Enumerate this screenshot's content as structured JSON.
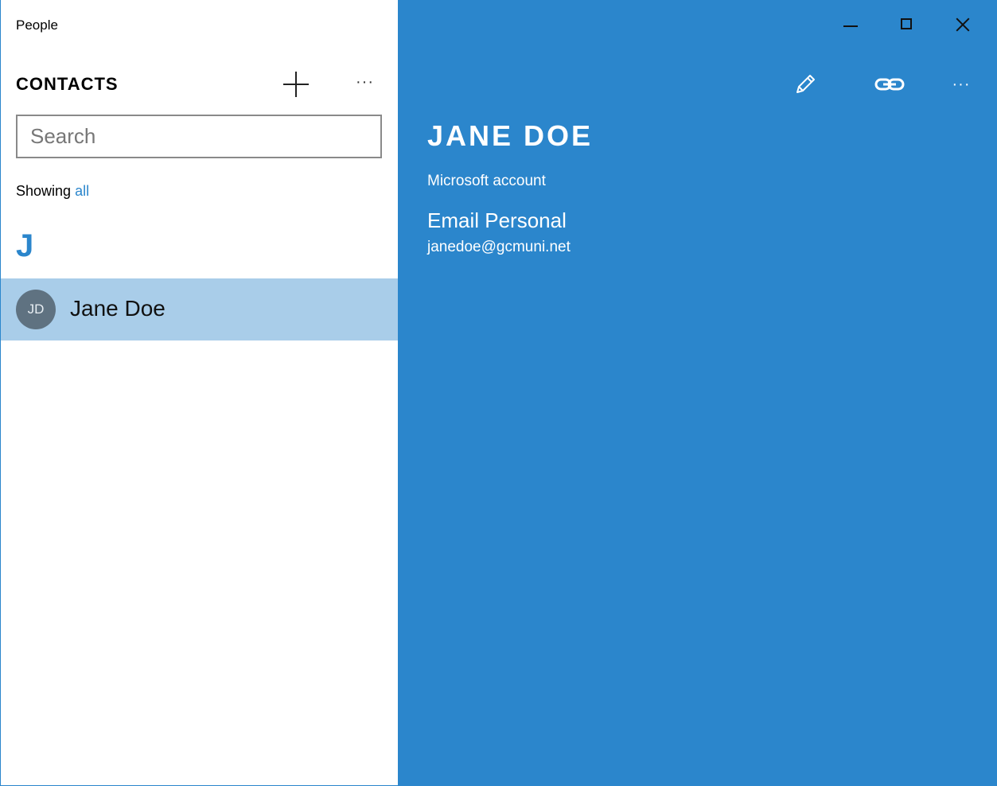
{
  "app": {
    "title": "People"
  },
  "sidebar": {
    "header": "CONTACTS",
    "add_icon": "plus-icon",
    "more_icon": "more-icon",
    "more_label": "···",
    "search": {
      "placeholder": "Search",
      "value": ""
    },
    "filter": {
      "prefix": "Showing",
      "value": "all"
    },
    "group_letter": "J",
    "contacts": [
      {
        "initials": "JD",
        "name": "Jane Doe",
        "selected": true
      }
    ]
  },
  "window_controls": {
    "minimize_icon": "minimize-icon",
    "maximize_icon": "maximize-icon",
    "close_icon": "close-icon"
  },
  "detail": {
    "toolbar": {
      "edit_icon": "pencil-icon",
      "link_icon": "link-icon",
      "more_label": "···"
    },
    "name": "JANE DOE",
    "account": "Microsoft account",
    "email_label": "Email Personal",
    "email_value": "janedoe@gcmuni.net"
  },
  "colors": {
    "accent": "#2b86cc",
    "selected_row": "#a9cde9",
    "avatar": "#5f7281"
  }
}
